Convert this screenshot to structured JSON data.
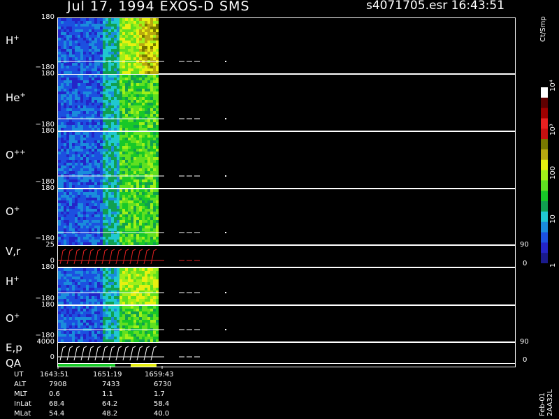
{
  "header": {
    "title": "Jul 17, 1994   EXOS-D SMS",
    "file": "s4071705.esr  16:43:51"
  },
  "panels": [
    {
      "label": "H",
      "sup": "+",
      "top_tick": "180",
      "bottom_tick": "−180"
    },
    {
      "label": "He",
      "sup": "+",
      "top_tick": "180",
      "bottom_tick": "−180"
    },
    {
      "label": "O",
      "sup": "++",
      "top_tick": "180",
      "bottom_tick": "−180"
    },
    {
      "label": "O",
      "sup": "+",
      "top_tick": "180",
      "bottom_tick": "−180"
    },
    {
      "label": "V,r",
      "sup": "",
      "top_tick": "25",
      "bottom_tick": "0",
      "right_top": "90",
      "right_bottom": "0"
    },
    {
      "label": "H",
      "sup": "+",
      "top_tick": "180",
      "bottom_tick": "−180"
    },
    {
      "label": "O",
      "sup": "+",
      "top_tick": "180",
      "bottom_tick": "−180"
    },
    {
      "label": "E,p",
      "sup": "",
      "top_tick": "4000",
      "bottom_tick": "0",
      "right_top": "90",
      "right_bottom": "0"
    }
  ],
  "qa_label": "QA",
  "colorbar": {
    "unit": "Ct/Smp",
    "ticks": [
      {
        "label": "1",
        "value": 1
      },
      {
        "label": "10",
        "value": 10
      },
      {
        "label": "100",
        "value": 100
      },
      {
        "label": "10³",
        "value": 1000
      },
      {
        "label": "10⁴",
        "value": 10000
      }
    ],
    "colors": [
      "#1a1a8c",
      "#2424c8",
      "#1c50e0",
      "#1a8cdc",
      "#20c8d0",
      "#10a050",
      "#18c828",
      "#60e020",
      "#a0f018",
      "#e8f010",
      "#b8a810",
      "#787800",
      "#c81010",
      "#e82020",
      "#a00000",
      "#600000",
      "#ffffff"
    ]
  },
  "orbit": {
    "labels": [
      "UT",
      "ALT",
      "MLT",
      "InLat",
      "MLat"
    ],
    "columns": [
      [
        "1643:51",
        "7908",
        "0.6",
        "68.4",
        "54.4"
      ],
      [
        "1651:19",
        "7433",
        "1.1",
        "64.2",
        "48.2"
      ],
      [
        "1659:43",
        "6730",
        "1.7",
        "58.4",
        "40.0"
      ]
    ]
  },
  "stamp": "Feb-01 2AA32L",
  "chart_data": {
    "type": "heatmap",
    "title": "Jul 17, 1994   EXOS-D SMS",
    "ylabel_panels": [
      "H+",
      "He+",
      "O++",
      "O+",
      "V,r",
      "H+",
      "O+",
      "E,p"
    ],
    "ylim": [
      -180,
      180
    ],
    "x_ticks": [
      "1643:51",
      "1651:19",
      "1659:43"
    ],
    "colorscale": {
      "unit": "Ct/Smp",
      "log": true,
      "range": [
        1,
        10000
      ]
    },
    "legend": "right"
  }
}
